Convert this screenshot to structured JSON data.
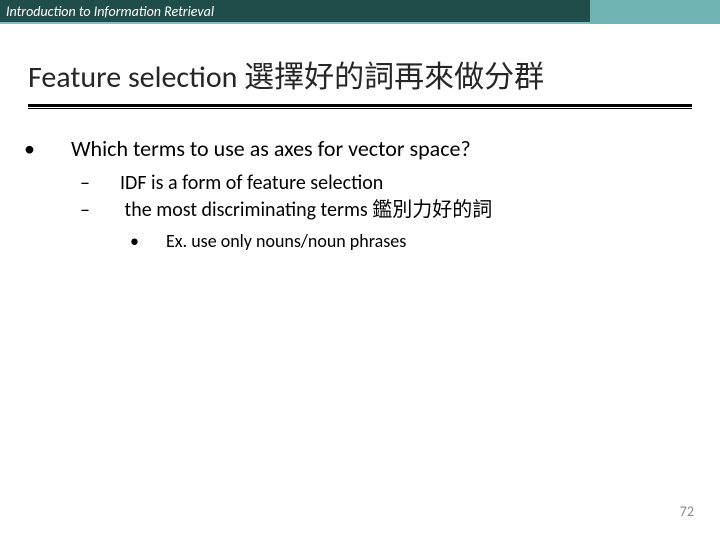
{
  "header": {
    "course": "Introduction to Information Retrieval"
  },
  "title": "Feature selection 選擇好的詞再來做分群",
  "bullets": {
    "l1": "Which terms to use as axes for vector space?",
    "l2a": "IDF is a form of feature selection",
    "l2b": "the most discriminating terms 鑑別力好的詞",
    "l3": "Ex. use only nouns/noun phrases"
  },
  "page": "72"
}
